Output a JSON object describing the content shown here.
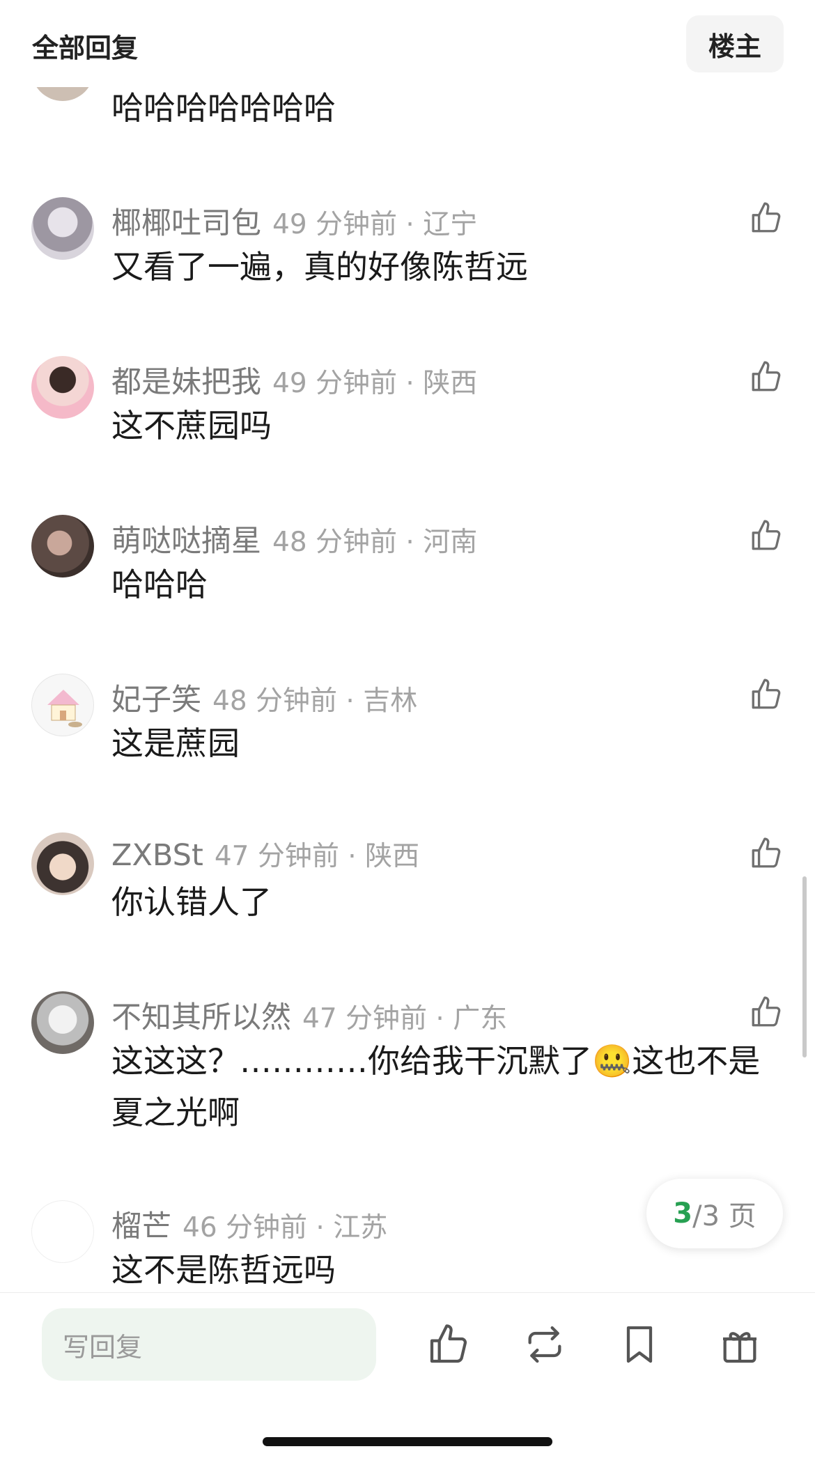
{
  "header": {
    "title": "全部回复",
    "op_filter_label": "楼主"
  },
  "comments": [
    {
      "name": "",
      "time": "",
      "location": "",
      "text": "哈哈哈哈哈哈哈"
    },
    {
      "name": "椰椰吐司包",
      "time": "49 分钟前",
      "location": "辽宁",
      "text": "又看了一遍，真的好像陈哲远"
    },
    {
      "name": "都是妹把我",
      "time": "49 分钟前",
      "location": "陕西",
      "text": "这不蔗园吗"
    },
    {
      "name": "萌哒哒摘星",
      "time": "48 分钟前",
      "location": "河南",
      "text": "哈哈哈"
    },
    {
      "name": "妃子笑",
      "time": "48 分钟前",
      "location": "吉林",
      "text": "这是蔗园"
    },
    {
      "name": "ZXBSt",
      "time": "47 分钟前",
      "location": "陕西",
      "text": "你认错人了"
    },
    {
      "name": "不知其所以然",
      "time": "47 分钟前",
      "location": "广东",
      "text_before_emoji": "这这这？…………你给我干沉默了",
      "emoji": "🤐",
      "text_after_emoji": "这也不是夏之光啊"
    },
    {
      "name": "榴芒",
      "time": "46 分钟前",
      "location": "江苏",
      "text": "这不是陈哲远吗"
    }
  ],
  "separator": " · ",
  "pager": {
    "current": "3",
    "total": "/3 页"
  },
  "bottom_bar": {
    "reply_placeholder": "写回复"
  },
  "colors": {
    "accent_green": "#27a052",
    "reply_bg": "#eef5ef"
  },
  "icons": [
    "thumbs-up-icon",
    "repost-icon",
    "bookmark-icon",
    "gift-icon"
  ]
}
